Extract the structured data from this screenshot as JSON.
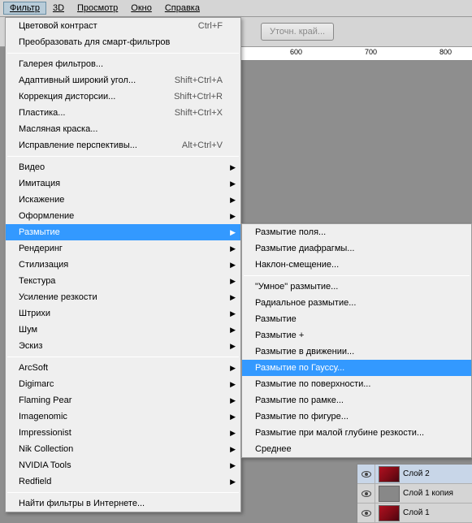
{
  "menubar": {
    "items": [
      "Фильтр",
      "3D",
      "Просмотр",
      "Окно",
      "Справка"
    ],
    "activeIndex": 0
  },
  "toolbar": {
    "refine_edge": "Уточн. край..."
  },
  "ruler": {
    "ticks": [
      "600",
      "700",
      "800"
    ]
  },
  "filter_menu": {
    "section1": [
      {
        "label": "Цветовой контраст",
        "shortcut": "Ctrl+F"
      },
      {
        "label": "Преобразовать для смарт-фильтров",
        "shortcut": ""
      }
    ],
    "section2": [
      {
        "label": "Галерея фильтров...",
        "shortcut": ""
      },
      {
        "label": "Адаптивный широкий угол...",
        "shortcut": "Shift+Ctrl+A"
      },
      {
        "label": "Коррекция дисторсии...",
        "shortcut": "Shift+Ctrl+R"
      },
      {
        "label": "Пластика...",
        "shortcut": "Shift+Ctrl+X"
      },
      {
        "label": "Масляная краска...",
        "shortcut": ""
      },
      {
        "label": "Исправление перспективы...",
        "shortcut": "Alt+Ctrl+V"
      }
    ],
    "section3": [
      "Видео",
      "Имитация",
      "Искажение",
      "Оформление",
      "Размытие",
      "Рендеринг",
      "Стилизация",
      "Текстура",
      "Усиление резкости",
      "Штрихи",
      "Шум",
      "Эскиз"
    ],
    "highlightedIndex": 4,
    "section4": [
      "ArcSoft",
      "Digimarc",
      "Flaming Pear",
      "Imagenomic",
      "Impressionist",
      "Nik Collection",
      "NVIDIA Tools",
      "Redfield"
    ],
    "section5": [
      {
        "label": "Найти фильтры в Интернете...",
        "shortcut": ""
      }
    ]
  },
  "blur_submenu": {
    "section1": [
      "Размытие поля...",
      "Размытие диафрагмы...",
      "Наклон-смещение..."
    ],
    "section2": [
      "\"Умное\" размытие...",
      "Радиальное размытие...",
      "Размытие",
      "Размытие +",
      "Размытие в движении...",
      "Размытие по Гауссу...",
      "Размытие по поверхности...",
      "Размытие по рамке...",
      "Размытие по фигуре...",
      "Размытие при малой глубине резкости...",
      "Среднее"
    ],
    "highlightedIndex": 5
  },
  "layers": {
    "rows": [
      {
        "name": "Слой 2",
        "selected": true,
        "thumb": "car"
      },
      {
        "name": "Слой 1 копия",
        "selected": false,
        "thumb": "gray"
      },
      {
        "name": "Слой 1",
        "selected": false,
        "thumb": "car"
      }
    ]
  }
}
